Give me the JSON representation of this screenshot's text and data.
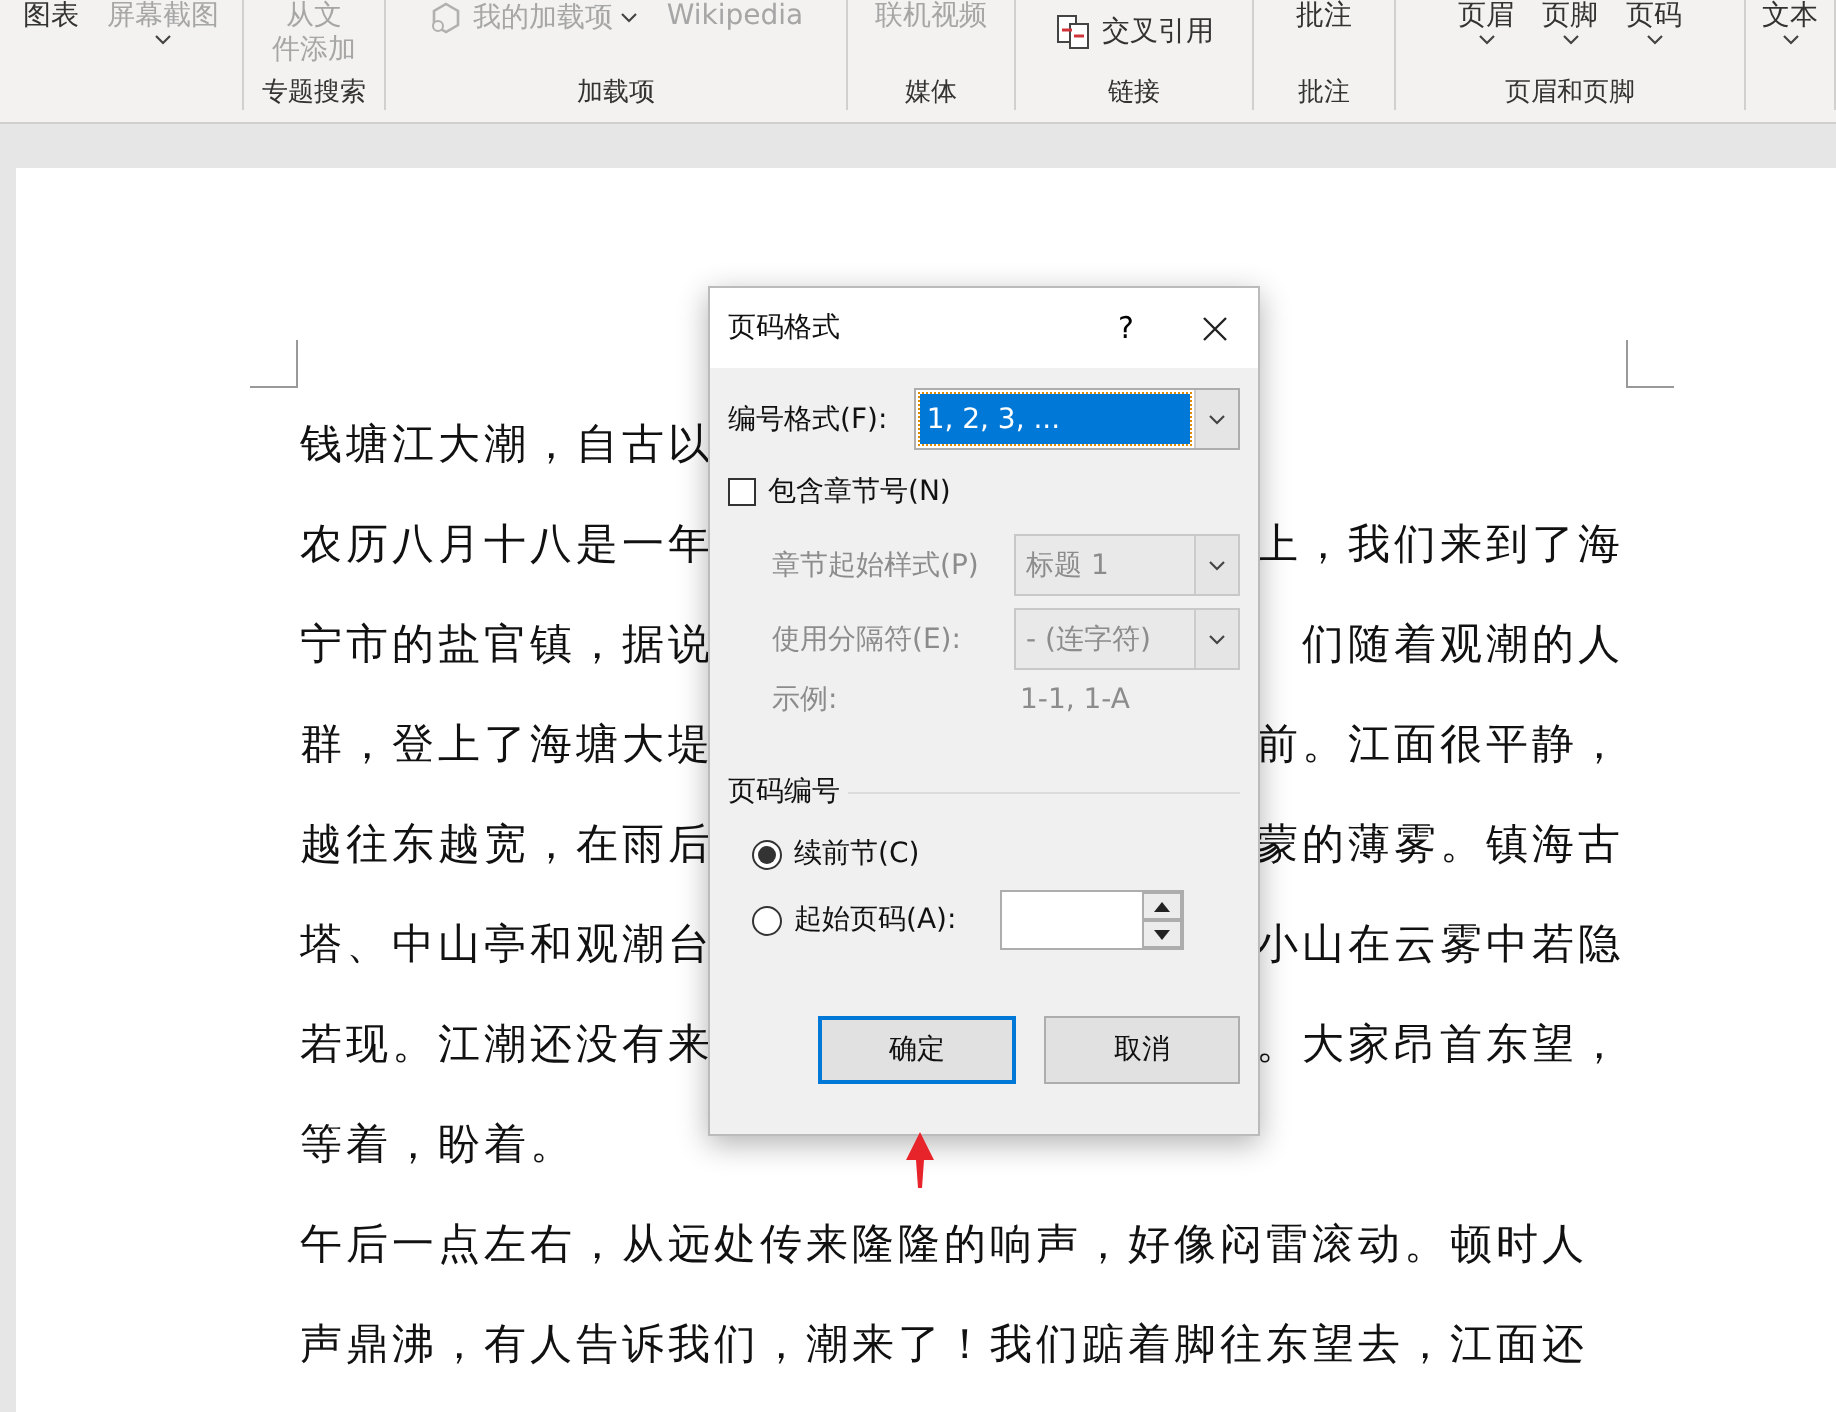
{
  "ribbon": {
    "groups": [
      {
        "commands": [
          {
            "kind": "large",
            "label": "图表",
            "disabled": false,
            "chevron": false
          },
          {
            "kind": "large",
            "label": "屏幕截图",
            "disabled": true,
            "chevron": true
          }
        ]
      },
      {
        "label": "专题搜索",
        "commands": [
          {
            "kind": "stacked",
            "lines": [
              "从文",
              "件添加"
            ],
            "disabled": true,
            "chevron": false
          }
        ]
      },
      {
        "label": "加载项",
        "commands": [
          {
            "kind": "addins",
            "label": "我的加载项",
            "disabled": true,
            "chevron": true
          },
          {
            "kind": "text",
            "label": "Wikipedia",
            "disabled": true,
            "chevron": false
          }
        ]
      },
      {
        "label": "媒体",
        "commands": [
          {
            "kind": "large",
            "label": "联机视频",
            "disabled": true,
            "chevron": false
          }
        ]
      },
      {
        "label": "链接",
        "commands": [
          {
            "kind": "crossref",
            "label": "交叉引用",
            "disabled": false,
            "chevron": false
          }
        ]
      },
      {
        "label": "批注",
        "commands": [
          {
            "kind": "large",
            "label": "批注",
            "disabled": false,
            "chevron": false
          }
        ]
      },
      {
        "label": "页眉和页脚",
        "commands": [
          {
            "kind": "large",
            "label": "页眉",
            "disabled": false,
            "chevron": true
          },
          {
            "kind": "large",
            "label": "页脚",
            "disabled": false,
            "chevron": true
          },
          {
            "kind": "large",
            "label": "页码",
            "disabled": false,
            "chevron": true
          }
        ]
      },
      {
        "commands": [
          {
            "kind": "large",
            "label": "文本",
            "disabled": false,
            "chevron": true
          }
        ]
      }
    ]
  },
  "document": {
    "lines": [
      {
        "left": "钱塘江大潮，自古以"
      },
      {
        "left": "农历八月十八是一年",
        "right": "上，我们来到了海"
      },
      {
        "left": "宁市的盐官镇，据说",
        "right": "们随着观潮的人"
      },
      {
        "left": "群，登上了海塘大堤",
        "right": "前。江面很平静，"
      },
      {
        "left": "越往东越宽，在雨后",
        "right": "蒙的薄雾。镇海古"
      },
      {
        "left": "塔、中山亭和观潮台",
        "right": "小山在云雾中若隐"
      },
      {
        "left": "若现。江潮还没有来",
        "right": "。大家昂首东望，"
      },
      {
        "left": "等着，盼着。"
      },
      {
        "left": "午后一点左右，从远处传来隆隆的响声，好像闷雷滚动。顿时人"
      },
      {
        "left": "声鼎沸，有人告诉我们，潮来了！我们踮着脚往东望去，江面还"
      }
    ]
  },
  "dialog": {
    "title": "页码格式",
    "help": "?",
    "number_format": {
      "label": "编号格式(F):",
      "value": "1, 2, 3, ..."
    },
    "include_chapter": {
      "label": "包含章节号(N)",
      "checked": false
    },
    "chapter_style": {
      "label": "章节起始样式(P)",
      "value": "标题 1",
      "disabled": true
    },
    "separator": {
      "label": "使用分隔符(E):",
      "value": "-  (连字符)",
      "disabled": true
    },
    "example": {
      "label": "示例:",
      "value": "1-1, 1-A",
      "disabled": true
    },
    "numbering": {
      "title": "页码编号",
      "options": [
        {
          "label": "续前节(C)",
          "selected": true
        },
        {
          "label": "起始页码(A):",
          "selected": false
        }
      ]
    },
    "buttons": [
      {
        "label": "确定",
        "default": true
      },
      {
        "label": "取消",
        "default": false
      }
    ]
  }
}
